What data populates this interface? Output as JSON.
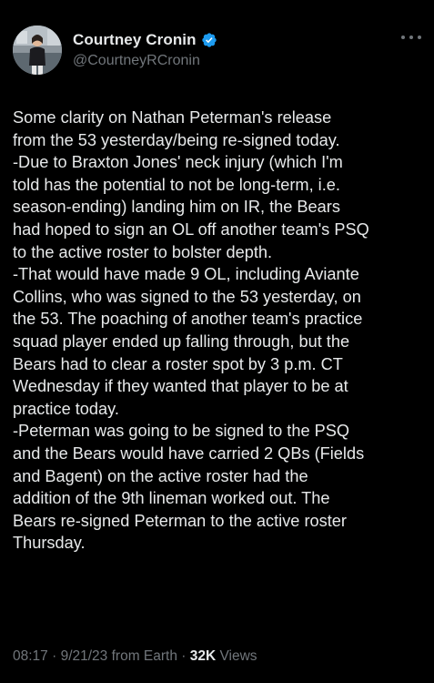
{
  "author": {
    "display_name": "Courtney Cronin",
    "handle": "@CourtneyRCronin",
    "verified_color": "#1d9bf0"
  },
  "tweet": {
    "lines": [
      "Some clarity on Nathan Peterman's release",
      "from the 53 yesterday/being re-signed today.",
      "-Due to Braxton Jones' neck injury (which I'm",
      "told has the potential to not be long-term, i.e.",
      "season-ending) landing him on IR, the Bears",
      "had hoped to sign an OL off another team's PSQ",
      "to the active roster to bolster depth.",
      "-That would have made 9 OL, including Aviante",
      "Collins, who was signed to the 53 yesterday, on",
      "the 53. The poaching of another team's practice",
      "squad player ended up falling through, but the",
      "Bears had to clear a roster spot by 3 p.m. CT",
      "Wednesday if they wanted that player to be at",
      "practice today.",
      "-Peterman was going to be signed to the PSQ",
      "and the Bears would have carried 2 QBs (Fields",
      "and Bagent) on the active roster had the",
      "addition of the 9th lineman worked out. The",
      "Bears re-signed Peterman to the active roster",
      "Thursday."
    ]
  },
  "meta": {
    "time": "08:17",
    "separator": " · ",
    "date": "9/21/23 from Earth",
    "views_count": "32K",
    "views_label": " Views"
  },
  "icons": {
    "verified": "verified-badge-icon",
    "more": "more-options-icon"
  }
}
